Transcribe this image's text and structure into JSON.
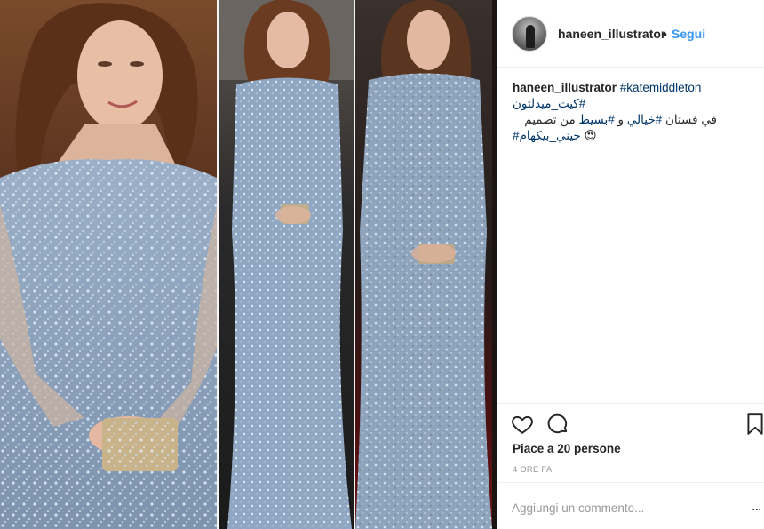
{
  "post": {
    "images": [
      {
        "name": "photo-closeup",
        "alt": ""
      },
      {
        "name": "photo-full-length-center",
        "alt": ""
      },
      {
        "name": "photo-full-length-right",
        "alt": ""
      }
    ]
  },
  "header": {
    "username": "haneen_illustrator",
    "separator": "•",
    "follow_label": "Segui",
    "avatar_icon": "profile-avatar"
  },
  "caption": {
    "username": "haneen_illustrator",
    "hashtag_1": "#katemiddleton",
    "hashtag_2": "كيت_ميدلتون#",
    "line_2_text_1": "في فستان ",
    "line_2_tag_1": "#خيالي",
    "line_2_text_2": " و ",
    "line_2_tag_2": "#بسيط",
    "line_2_text_3": " من تصميم",
    "line_3_tag": "#جيني_بيكهام",
    "line_3_emoji": "😍"
  },
  "actions": {
    "like_icon": "heart-icon",
    "comment_icon": "comment-bubble-icon",
    "save_icon": "bookmark-icon"
  },
  "likes_text": "Piace a 20 persone",
  "timestamp": "4 ORE FA",
  "comment": {
    "placeholder": "Aggiungi un commento...",
    "more_label": "..."
  },
  "colors": {
    "link": "#3897f0",
    "hashtag": "#003569",
    "muted": "#999999",
    "text": "#262626",
    "border": "#efefef",
    "dress": "#8fa7c2"
  }
}
